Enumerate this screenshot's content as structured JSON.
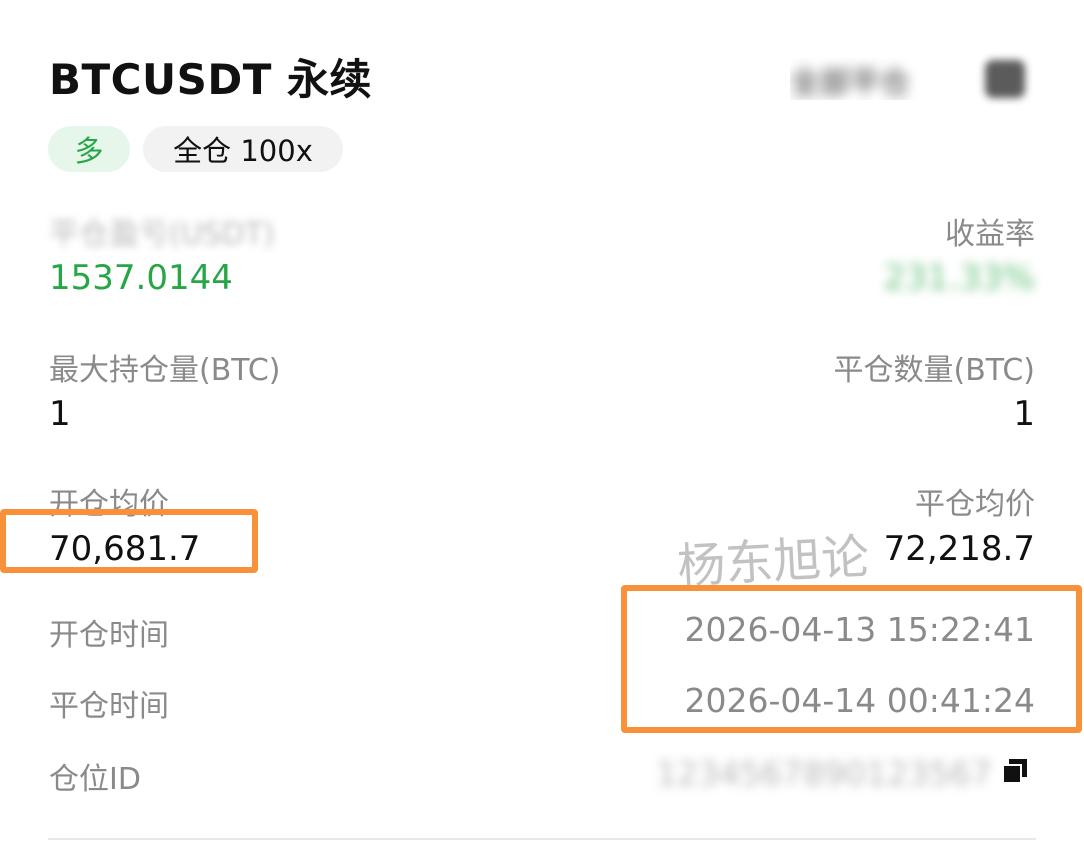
{
  "header": {
    "title": "BTCUSDT 永续",
    "top_right_text": "全部平仓",
    "badges": {
      "side": "多",
      "margin_mode": "全仓 100x"
    }
  },
  "stats": {
    "pnl_label": "平仓盈亏(USDT)",
    "pnl_value": "1537.0144",
    "roi_label": "收益率",
    "roi_value": "231.33%",
    "max_position_label": "最大持仓量(BTC)",
    "max_position_value": "1",
    "close_qty_label": "平仓数量(BTC)",
    "close_qty_value": "1",
    "open_avg_label": "开仓均价",
    "open_avg_value": "70,681.7",
    "close_avg_label": "平仓均价",
    "close_avg_value": "72,218.7"
  },
  "times": {
    "open_time_label": "开仓时间",
    "open_time_value": "2026-04-13 15:22:41",
    "close_time_label": "平仓时间",
    "close_time_value": "2026-04-14 00:41:24"
  },
  "position": {
    "id_label": "仓位ID",
    "id_value": "1234567890123567"
  },
  "watermark": "杨东旭论",
  "colors": {
    "green": "#27a646",
    "highlight": "#f7923a",
    "label_gray": "#8a8a8a"
  },
  "icons": {
    "copy": "copy-icon"
  }
}
